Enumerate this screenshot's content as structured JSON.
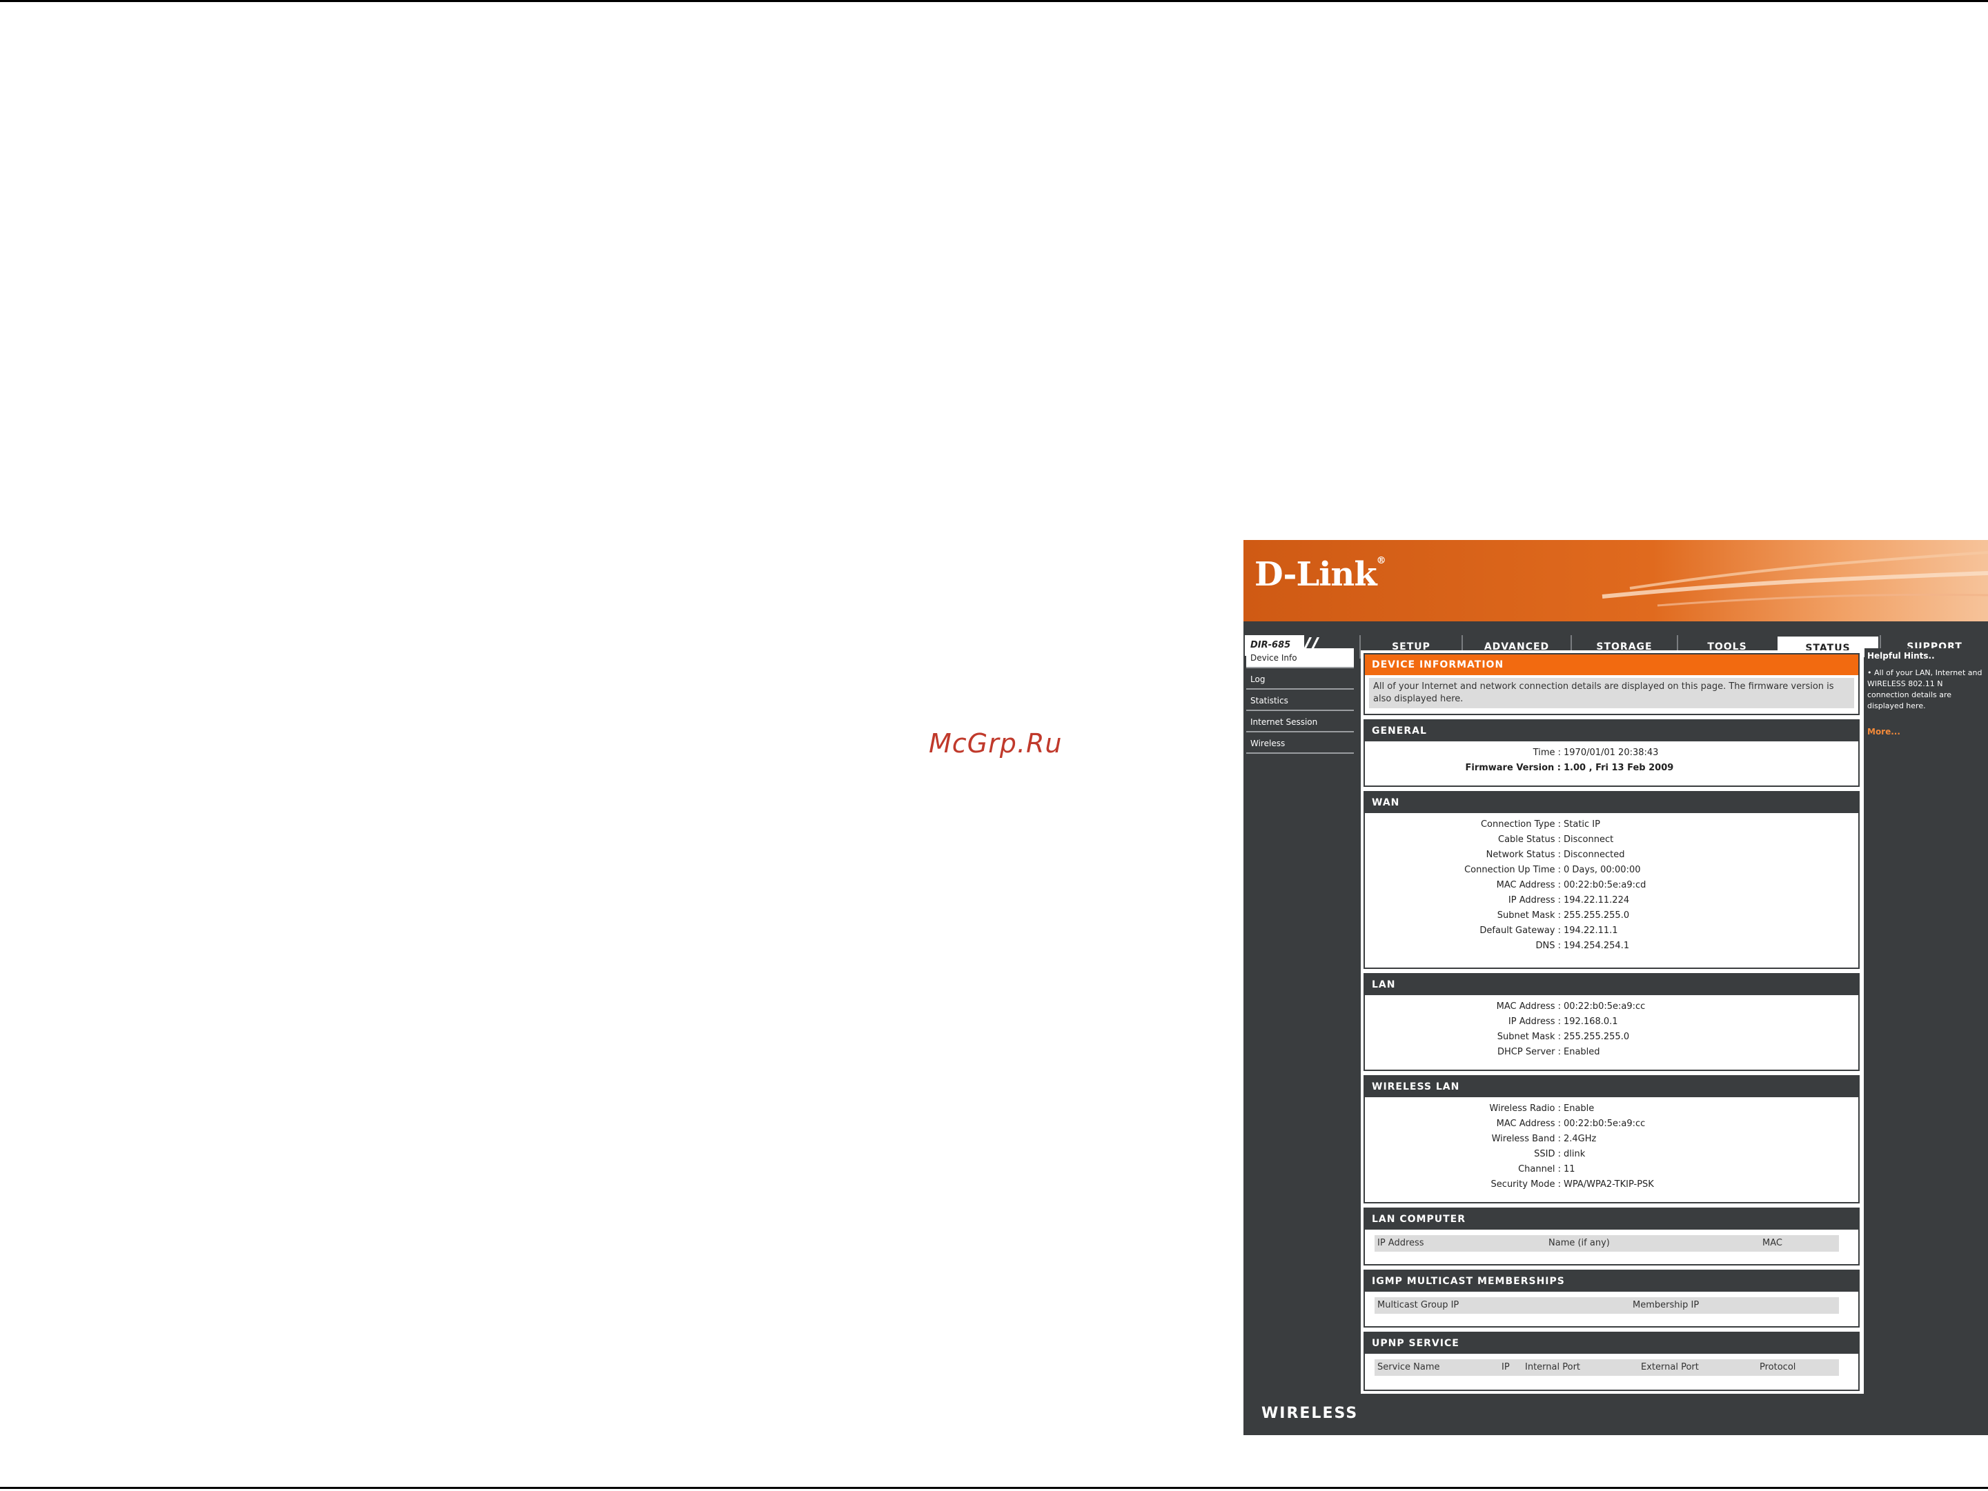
{
  "watermark": "McGrp.Ru",
  "logo": {
    "text": "D-Link",
    "mark": "®"
  },
  "model": "DIR-685",
  "tabs": [
    {
      "label": "SETUP"
    },
    {
      "label": "ADVANCED"
    },
    {
      "label": "STORAGE"
    },
    {
      "label": "TOOLS"
    },
    {
      "label": "STATUS"
    },
    {
      "label": "SUPPORT"
    }
  ],
  "active_tab": "STATUS",
  "sidebar": {
    "items": [
      {
        "label": "Device Info"
      },
      {
        "label": "Log"
      },
      {
        "label": "Statistics"
      },
      {
        "label": "Internet Session"
      },
      {
        "label": "Wireless"
      }
    ]
  },
  "device_info": {
    "title": "DEVICE INFORMATION",
    "text": "All of your Internet and network connection details are displayed on this page. The firmware version is also displayed here."
  },
  "general": {
    "title": "GENERAL",
    "time_label": "Time :",
    "time": "1970/01/01 20:38:43",
    "firmware_label": "Firmware Version :",
    "firmware": "1.00 ,  Fri 13 Feb 2009"
  },
  "wan": {
    "title": "WAN",
    "rows": [
      {
        "k": "Connection Type :",
        "v": "Static IP"
      },
      {
        "k": "Cable Status :",
        "v": "Disconnect"
      },
      {
        "k": "Network Status :",
        "v": "Disconnected"
      },
      {
        "k": "Connection Up Time :",
        "v": "0 Days, 00:00:00"
      },
      {
        "k": "MAC Address :",
        "v": "00:22:b0:5e:a9:cd"
      },
      {
        "k": "IP Address :",
        "v": "194.22.11.224"
      },
      {
        "k": "Subnet Mask :",
        "v": "255.255.255.0"
      },
      {
        "k": "Default Gateway :",
        "v": "194.22.11.1"
      },
      {
        "k": "DNS :",
        "v": "194.254.254.1"
      }
    ]
  },
  "lan": {
    "title": "LAN",
    "rows": [
      {
        "k": "MAC Address :",
        "v": "00:22:b0:5e:a9:cc"
      },
      {
        "k": "IP Address :",
        "v": "192.168.0.1"
      },
      {
        "k": "Subnet Mask :",
        "v": "255.255.255.0"
      },
      {
        "k": "DHCP Server :",
        "v": "Enabled"
      }
    ]
  },
  "wireless_lan": {
    "title": "WIRELESS LAN",
    "rows": [
      {
        "k": "Wireless Radio :",
        "v": "Enable"
      },
      {
        "k": "MAC Address :",
        "v": "00:22:b0:5e:a9:cc"
      },
      {
        "k": "Wireless Band :",
        "v": "2.4GHz"
      },
      {
        "k": "SSID :",
        "v": "dlink"
      },
      {
        "k": "Channel :",
        "v": "11"
      },
      {
        "k": "Security Mode :",
        "v": "WPA/WPA2-TKIP-PSK"
      }
    ]
  },
  "lan_computer": {
    "title": "LAN COMPUTER",
    "cols": [
      "IP Address",
      "Name (if any)",
      "MAC"
    ]
  },
  "igmp": {
    "title": "IGMP MULTICAST MEMBERSHIPS",
    "cols": [
      "Multicast Group IP",
      "Membership IP"
    ]
  },
  "upnp": {
    "title": "UPNP SERVICE",
    "cols": [
      "Service Name",
      "IP",
      "Internal Port",
      "External Port",
      "Protocol"
    ]
  },
  "hints": {
    "title": "Helpful Hints..",
    "text": "• All of your LAN, Internet and WIRELESS 802.11 N connection details are displayed here.",
    "more": "More..."
  },
  "footer": {
    "text": "WIRELESS"
  }
}
